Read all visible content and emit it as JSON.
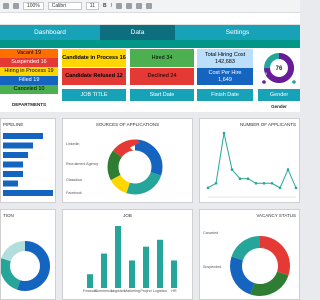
{
  "toolbar": {
    "zoom": "100%",
    "font": "Calibri",
    "size": "11"
  },
  "nav": [
    {
      "label": "Dashboard",
      "color": "#17a2b8"
    },
    {
      "label": "Data",
      "color": "#0d6f7e"
    },
    {
      "label": "Settings",
      "color": "#17a2b8"
    }
  ],
  "department": {
    "rows": [
      {
        "text": "Vacant 19",
        "bg": "#ff6f00",
        "fg": "#000"
      },
      {
        "text": "Suspended 16",
        "bg": "#e53935",
        "fg": "#fff"
      },
      {
        "text": "Hiring in Process 19",
        "bg": "#ffd600",
        "fg": "#000"
      },
      {
        "text": "Filled 19",
        "bg": "#1565c0",
        "fg": "#fff"
      },
      {
        "text": "Canceled 10",
        "bg": "#4caf50",
        "fg": "#000"
      }
    ],
    "label": "DEPARTMENTS"
  },
  "jobtitle": {
    "rows": [
      {
        "text": "Candidate in Process 16",
        "bg": "#ffd600",
        "fg": "#000"
      },
      {
        "text": "Candidate Refused 12",
        "bg": "#e53935",
        "fg": "#000"
      }
    ],
    "label": "JOB TITLE"
  },
  "startdate": {
    "rows": [
      {
        "text": "Hired 34",
        "bg": "#4caf50",
        "fg": "#000"
      },
      {
        "text": "Declined 24",
        "bg": "#e53935",
        "fg": "#000"
      }
    ],
    "label": "Start Date"
  },
  "finish": {
    "total_label": "Total Hiring Cost",
    "total_value": "142,683",
    "cost_label": "Cost Per Hire",
    "cost_value": "1,649",
    "label": "Finish Date"
  },
  "gender": {
    "value": "76",
    "small": "8",
    "label": "Gender",
    "header": "Gender"
  },
  "charts": {
    "pipeline_title": "PIPELINE",
    "sources_title": "SOURCES OF APPLICATIONS",
    "applicants_title": "NUMBER OF APPLICANTS",
    "bottom_left_title": "TION",
    "job_title": "JOB",
    "vacancy_title": "VACANCY STATUS"
  },
  "sources_labels": [
    "Linkedin",
    "Recruitment Agency",
    "Glassdoor",
    "Facebook"
  ],
  "job_labels": [
    "Financial analyst",
    "Commercial Manager",
    "Logistics Coordinator",
    "Marketing Analyst",
    "Project Coordinator",
    "Logistics Coordinator",
    "HR Analyst"
  ],
  "vacancy_labels": [
    "Canceled",
    "Suspended"
  ],
  "chart_data": [
    {
      "type": "bar",
      "title": "PIPELINE",
      "orientation": "horizontal",
      "values": [
        16,
        12,
        10,
        8,
        8,
        6,
        20
      ],
      "color": "#1565c0"
    },
    {
      "type": "pie",
      "title": "SOURCES OF APPLICATIONS",
      "values": [
        30,
        25,
        12,
        18,
        15
      ],
      "colors": [
        "#1565c0",
        "#26a69a",
        "#ffd600",
        "#2e7d32",
        "#e53935"
      ]
    },
    {
      "type": "line",
      "title": "NUMBER OF APPLICANTS",
      "values": [
        2,
        3,
        14,
        6,
        4,
        4,
        3,
        3,
        3,
        2,
        6,
        2
      ],
      "color": "#26a69a"
    },
    {
      "type": "pie",
      "title": "TION",
      "values": [
        55,
        25,
        20
      ],
      "colors": [
        "#1565c0",
        "#26a69a",
        "#b2dfdb"
      ]
    },
    {
      "type": "bar",
      "title": "JOB",
      "categories": [
        "Financial analyst",
        "Commercial Manager",
        "Logistics Coordinator",
        "Marketing Analyst",
        "Project Coordinator",
        "Logistics Coordinator",
        "HR Analyst"
      ],
      "values": [
        2,
        5,
        9,
        4,
        6,
        7,
        4
      ],
      "color": "#26a69a"
    },
    {
      "type": "pie",
      "title": "VACANCY STATUS",
      "values": [
        30,
        25,
        25,
        20
      ],
      "colors": [
        "#e53935",
        "#2e7d32",
        "#1565c0",
        "#26a69a"
      ]
    }
  ]
}
